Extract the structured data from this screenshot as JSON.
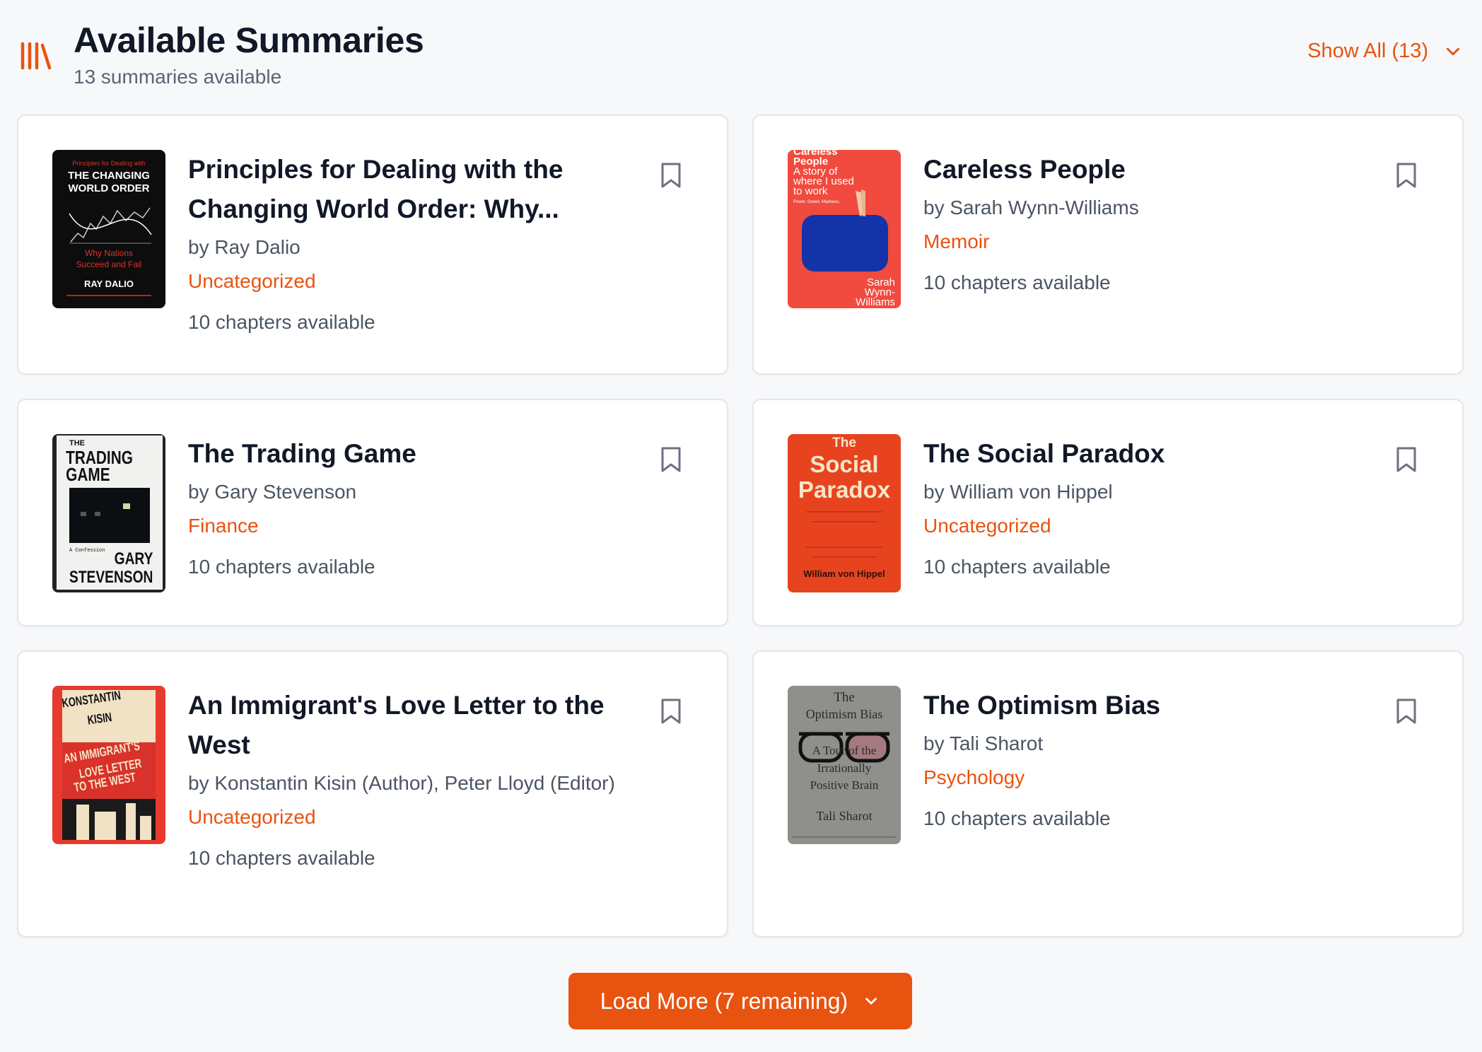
{
  "header": {
    "title": "Available Summaries",
    "subtitle": "13 summaries available",
    "show_all": "Show All (13)"
  },
  "colors": {
    "accent": "#e8530f",
    "text": "#111827",
    "muted": "#4b5563"
  },
  "books": [
    {
      "title": "Principles for Dealing with the Changing World Order: Why...",
      "author": "by Ray Dalio",
      "category": "Uncategorized",
      "chapters": "10 chapters available",
      "cover_text": [
        "Principles for Dealing with",
        "THE CHANGING",
        "WORLD ORDER",
        "Why Nations",
        "Succeed and Fail",
        "RAY DALIO"
      ]
    },
    {
      "title": "Careless People",
      "author": "by Sarah Wynn-Williams",
      "category": "Memoir",
      "chapters": "10 chapters available",
      "cover_text": [
        "Careless",
        "People",
        "A story of",
        "where I used",
        "to work",
        "Power. Greed. Madness.",
        "Sarah",
        "Wynn-",
        "Williams"
      ]
    },
    {
      "title": "The Trading Game",
      "author": "by Gary Stevenson",
      "category": "Finance",
      "chapters": "10 chapters available",
      "cover_text": [
        "THE",
        "TRADING",
        "GAME",
        "A Confession",
        "GARY",
        "STEVENSON"
      ]
    },
    {
      "title": "The Social Paradox",
      "author": "by William von Hippel",
      "category": "Uncategorized",
      "chapters": "10 chapters available",
      "cover_text": [
        "The",
        "Social",
        "Paradox",
        "William von Hippel"
      ]
    },
    {
      "title": "An Immigrant's Love Letter to the West",
      "author": "by Konstantin Kisin (Author), Peter Lloyd (Editor)",
      "category": "Uncategorized",
      "chapters": "10 chapters available",
      "cover_text": [
        "KONSTANTIN",
        "KISIN",
        "AN IMMIGRANT'S",
        "LOVE LETTER",
        "TO THE WEST"
      ]
    },
    {
      "title": "The Optimism Bias",
      "author": "by Tali Sharot",
      "category": "Psychology",
      "chapters": "10 chapters available",
      "cover_text": [
        "The",
        "Optimism Bias",
        "A Tour of the",
        "Irrationally",
        "Positive Brain",
        "Tali Sharot"
      ]
    }
  ],
  "load_more": "Load More (7 remaining)"
}
